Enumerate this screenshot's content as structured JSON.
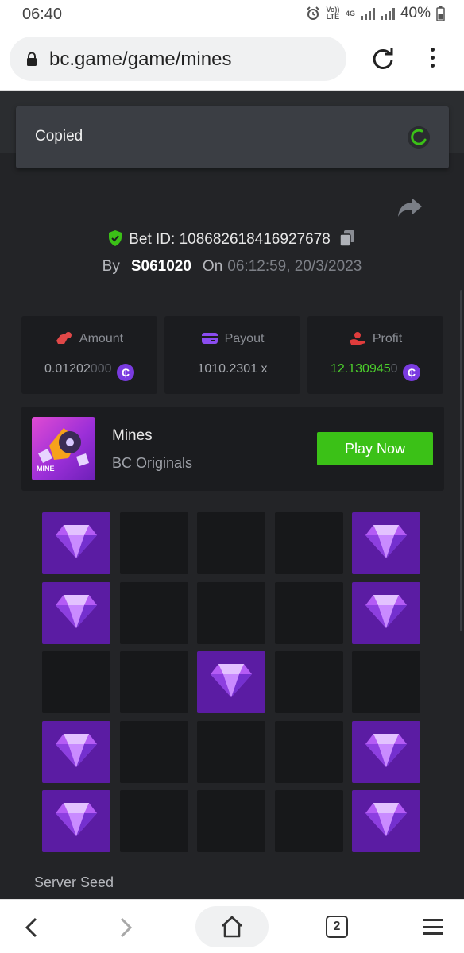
{
  "status": {
    "time": "06:40",
    "volte": "Vo)) LTE",
    "network": "4G",
    "battery": "40%"
  },
  "browser": {
    "url": "bc.game/game/mines",
    "tab_count": "2"
  },
  "toast": {
    "message": "Copied"
  },
  "bet": {
    "id_label": "Bet ID: 108682618416927678",
    "by_label": "By",
    "user": "S061020",
    "on_label": "On",
    "timestamp": "06:12:59, 20/3/2023"
  },
  "stats": {
    "amount": {
      "label": "Amount",
      "value_main": "0.01202",
      "value_dim": "000"
    },
    "payout": {
      "label": "Payout",
      "value": "1010.2301 x"
    },
    "profit": {
      "label": "Profit",
      "value_main": "12.130945",
      "value_dim": "0"
    },
    "coin_symbol": "₵"
  },
  "game": {
    "title": "Mines",
    "subtitle": "BC Originals",
    "thumb_label": "MINE",
    "play_label": "Play Now"
  },
  "board": {
    "rows": [
      [
        1,
        0,
        0,
        0,
        1
      ],
      [
        1,
        0,
        0,
        0,
        1
      ],
      [
        0,
        0,
        1,
        0,
        0
      ],
      [
        1,
        0,
        0,
        0,
        1
      ],
      [
        1,
        0,
        0,
        0,
        1
      ]
    ]
  },
  "section": {
    "server_seed_label": "Server Seed"
  },
  "colors": {
    "accent_green": "#3bc117",
    "profit_green": "#4ccf2c",
    "gem_tile": "#5b1ca3",
    "coin_purple": "#7a3be0",
    "background": "#232427"
  },
  "icons": {
    "lock": "lock-icon",
    "reload": "reload-icon",
    "share": "share-icon",
    "shield": "shield-check-icon",
    "copy": "copy-icon",
    "gem": "diamond-icon"
  }
}
